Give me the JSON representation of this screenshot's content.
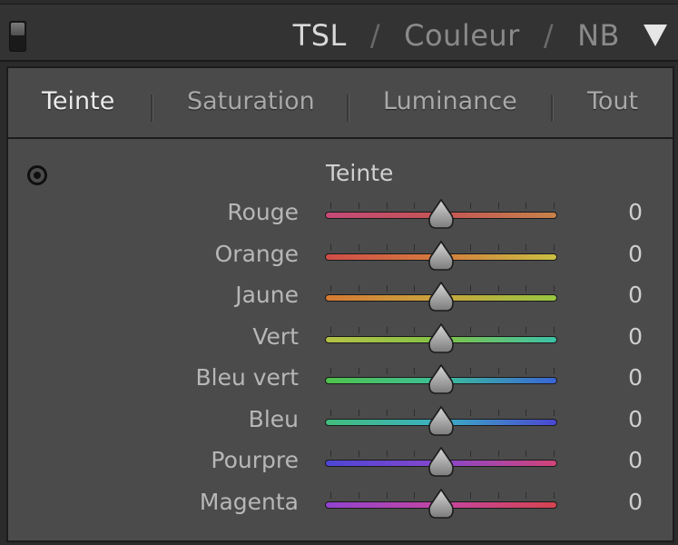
{
  "header": {
    "modes": [
      "TSL",
      "Couleur",
      "NB"
    ],
    "separator": "/",
    "active_mode": "TSL",
    "menu_icon": "triangle-down-icon"
  },
  "tabs": [
    {
      "label": "Teinte",
      "active": true
    },
    {
      "label": "Saturation",
      "active": false
    },
    {
      "label": "Luminance",
      "active": false
    },
    {
      "label": "Tout",
      "active": false
    }
  ],
  "panel": {
    "section_title": "Teinte",
    "target_tool_icon": "target-adjustment-icon",
    "sliders": [
      {
        "label": "Rouge",
        "value": "0",
        "level": 0.5,
        "colors": [
          "#c54a78",
          "#c35555",
          "#c7824a"
        ]
      },
      {
        "label": "Orange",
        "value": "0",
        "level": 0.5,
        "colors": [
          "#cf4d48",
          "#d57d3d",
          "#c9c043"
        ]
      },
      {
        "label": "Jaune",
        "value": "0",
        "level": 0.5,
        "colors": [
          "#d47a34",
          "#c9a53e",
          "#97c740"
        ]
      },
      {
        "label": "Vert",
        "value": "0",
        "level": 0.5,
        "colors": [
          "#b6c246",
          "#82c246",
          "#3cc2a8"
        ]
      },
      {
        "label": "Bleu vert",
        "value": "0",
        "level": 0.5,
        "colors": [
          "#4fc24b",
          "#3cbf9a",
          "#3a64d6"
        ]
      },
      {
        "label": "Bleu",
        "value": "0",
        "level": 0.5,
        "colors": [
          "#41bd7b",
          "#3ab0c4",
          "#4b46d2"
        ]
      },
      {
        "label": "Pourpre",
        "value": "0",
        "level": 0.5,
        "colors": [
          "#4c46d4",
          "#8747cc",
          "#d14478"
        ]
      },
      {
        "label": "Magenta",
        "value": "0",
        "level": 0.5,
        "colors": [
          "#9143d0",
          "#c545a2",
          "#d4444f"
        ]
      }
    ]
  }
}
